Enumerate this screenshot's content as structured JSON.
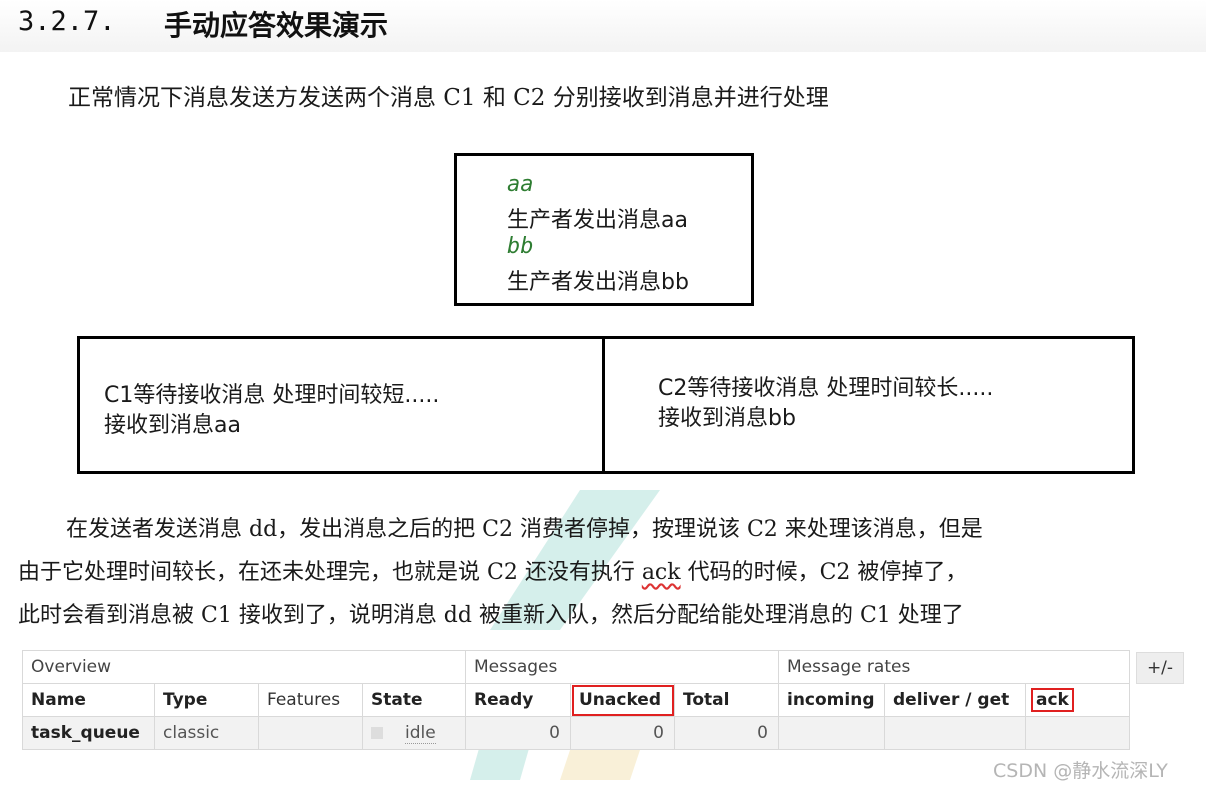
{
  "section": {
    "number": "3.2.7.",
    "title": "手动应答效果演示"
  },
  "para1": "正常情况下消息发送方发送两个消息 C1 和 C2 分别接收到消息并进行处理",
  "producer_box": {
    "line1": "aa",
    "line2": "生产者发出消息aa",
    "line3": "bb",
    "line4": "生产者发出消息bb"
  },
  "consumer_boxes": {
    "c1_line1": "C1等待接收消息 处理时间较短.....",
    "c1_line2": "接收到消息aa",
    "c2_line1": "C2等待接收消息 处理时间较长.....",
    "c2_line2": "接收到消息bb"
  },
  "para2": {
    "line1": "在发送者发送消息 dd，发出消息之后的把 C2 消费者停掉，按理说该 C2 来处理该消息，但是",
    "line2_a": "由于它处理时间较长，在还未处理完，也就是说 C2 还没有执行 ",
    "line2_ack": "ack",
    "line2_b": " 代码的时候，C2 被停掉了，",
    "line3": "此时会看到消息被 C1 接收到了，说明消息 dd 被重新入队，然后分配给能处理消息的 C1 处理了"
  },
  "table": {
    "groups": {
      "overview": "Overview",
      "messages": "Messages",
      "rates": "Message rates"
    },
    "headers": {
      "name": "Name",
      "type": "Type",
      "features": "Features",
      "state": "State",
      "ready": "Ready",
      "unacked": "Unacked",
      "total": "Total",
      "incoming": "incoming",
      "deliver_get": "deliver / get",
      "ack": "ack"
    },
    "row": {
      "name": "task_queue",
      "type": "classic",
      "features": "",
      "state": "idle",
      "ready": "0",
      "unacked": "0",
      "total": "0"
    },
    "toggle": "+/-"
  },
  "watermark_text": "CSDN @静水流深LY",
  "colors": {
    "highlight_box": "#e02020",
    "italic_green": "#2e7d32"
  }
}
